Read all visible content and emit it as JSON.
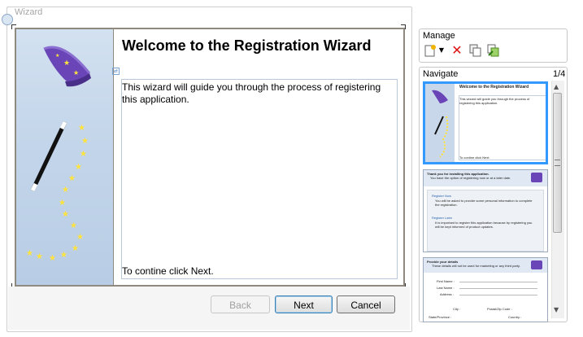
{
  "window": {
    "title": "Wizard"
  },
  "wizard_page": {
    "heading": "Welcome to the Registration Wizard",
    "intro": "This wizard will guide you through the process of registering this application.",
    "continue_hint": "To contine click Next."
  },
  "buttons": {
    "back": "Back",
    "next": "Next",
    "cancel": "Cancel"
  },
  "manage": {
    "label": "Manage",
    "tools": [
      "new-page-icon",
      "dropdown-arrow-icon",
      "delete-icon",
      "copy-page-icon",
      "paste-page-icon"
    ]
  },
  "navigate": {
    "label": "Navigate",
    "counter": "1/4",
    "thumbnails": [
      {
        "title": "Welcome to the Registration Wizard",
        "text": "This wizard will guide you through the process of registering this application.",
        "footer": "To contine click Next.",
        "selected": true
      },
      {
        "title": "Thank you for installing this application.",
        "text": "You have the option of registering now or at a later date.",
        "options": [
          {
            "label": "Register Now",
            "desc": "You will be asked to provide some personal information to complete the registration."
          },
          {
            "label": "Register Later",
            "desc": "It is important to register this application because by registering you will be kept informed of product updates."
          }
        ]
      },
      {
        "title": "Provide your details",
        "subtitle": "These details will not be used for marketing or any third party.",
        "fields": [
          "First Name :",
          "Last Name :",
          "Address :",
          "City :",
          "Postal/Zip Code :",
          "State/Province :",
          "Country :"
        ]
      }
    ]
  },
  "colors": {
    "accent": "#3399ff",
    "panel": "#c3d5ea",
    "border": "#8f8a80"
  }
}
